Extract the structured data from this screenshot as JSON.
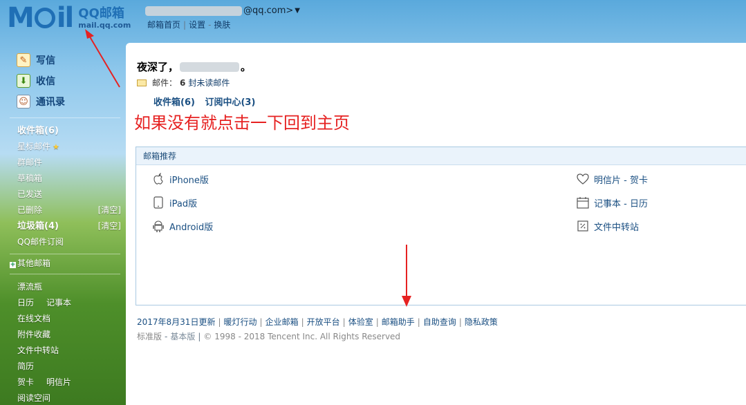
{
  "header": {
    "logo_mark": "M  il",
    "logo_cn": "QQ邮箱",
    "logo_url": "mail.qq.com",
    "account_suffix": "@qq.com>",
    "links": [
      "邮箱首页",
      "设置",
      "换肤"
    ],
    "link_sep": "|",
    "link_dash": "-"
  },
  "sidebar": {
    "primary": [
      {
        "label": "写信",
        "icon": "compose-icon"
      },
      {
        "label": "收信",
        "icon": "inbox-download-icon"
      },
      {
        "label": "通讯录",
        "icon": "contacts-icon"
      }
    ],
    "folders": [
      {
        "label": "收件箱(6)",
        "bold": true,
        "action": ""
      },
      {
        "label": "星标邮件",
        "bold": false,
        "action": "",
        "star": "★"
      },
      {
        "label": "群邮件",
        "bold": false,
        "action": ""
      },
      {
        "label": "草稿箱",
        "bold": false,
        "action": ""
      },
      {
        "label": "已发送",
        "bold": false,
        "action": ""
      },
      {
        "label": "已删除",
        "bold": false,
        "action": "[清空]"
      },
      {
        "label": "垃圾箱(4)",
        "bold": true,
        "action": "[清空]"
      },
      {
        "label": "QQ邮件订阅",
        "bold": false,
        "action": ""
      }
    ],
    "other_mailboxes": "其他邮箱",
    "tools": [
      [
        "漂流瓶"
      ],
      [
        "日历",
        "记事本"
      ],
      [
        "在线文档"
      ],
      [
        "附件收藏"
      ],
      [
        "文件中转站"
      ],
      [
        "简历"
      ],
      [
        "贺卡",
        "明信片"
      ],
      [
        "阅读空间"
      ]
    ]
  },
  "main": {
    "greeting_prefix": "夜深了，",
    "greeting_suffix": "。",
    "mail_label": "邮件：",
    "unread_count": "6",
    "unread_text": "封未读邮件",
    "quick_links": [
      "收件箱(6)",
      "订阅中心(3)"
    ],
    "annotation": "如果没有就点击一下回到主页",
    "recommend": {
      "title": "邮箱推荐",
      "left": [
        {
          "label": "iPhone版",
          "icon": "apple-icon"
        },
        {
          "label": "iPad版",
          "icon": "ipad-icon"
        },
        {
          "label": "Android版",
          "icon": "android-icon"
        }
      ],
      "right": [
        {
          "label": "明信片 - 贺卡",
          "icon": "heart-icon"
        },
        {
          "label": "记事本 - 日历",
          "icon": "calendar-icon"
        },
        {
          "label": "文件中转站",
          "icon": "file-transfer-icon"
        }
      ]
    },
    "footer_links": [
      "2017年8月31日更新",
      "暖灯行动",
      "企业邮箱",
      "开放平台",
      "体验室",
      "邮箱助手",
      "自助查询",
      "隐私政策"
    ],
    "footer_standard": "标准版",
    "footer_basic": "基本版",
    "copyright": "© 1998 - 2018 Tencent Inc. All Rights Reserved"
  },
  "colors": {
    "link": "#1a4f82",
    "annotation": "#e62121",
    "panel_border": "#a9c9e2"
  }
}
